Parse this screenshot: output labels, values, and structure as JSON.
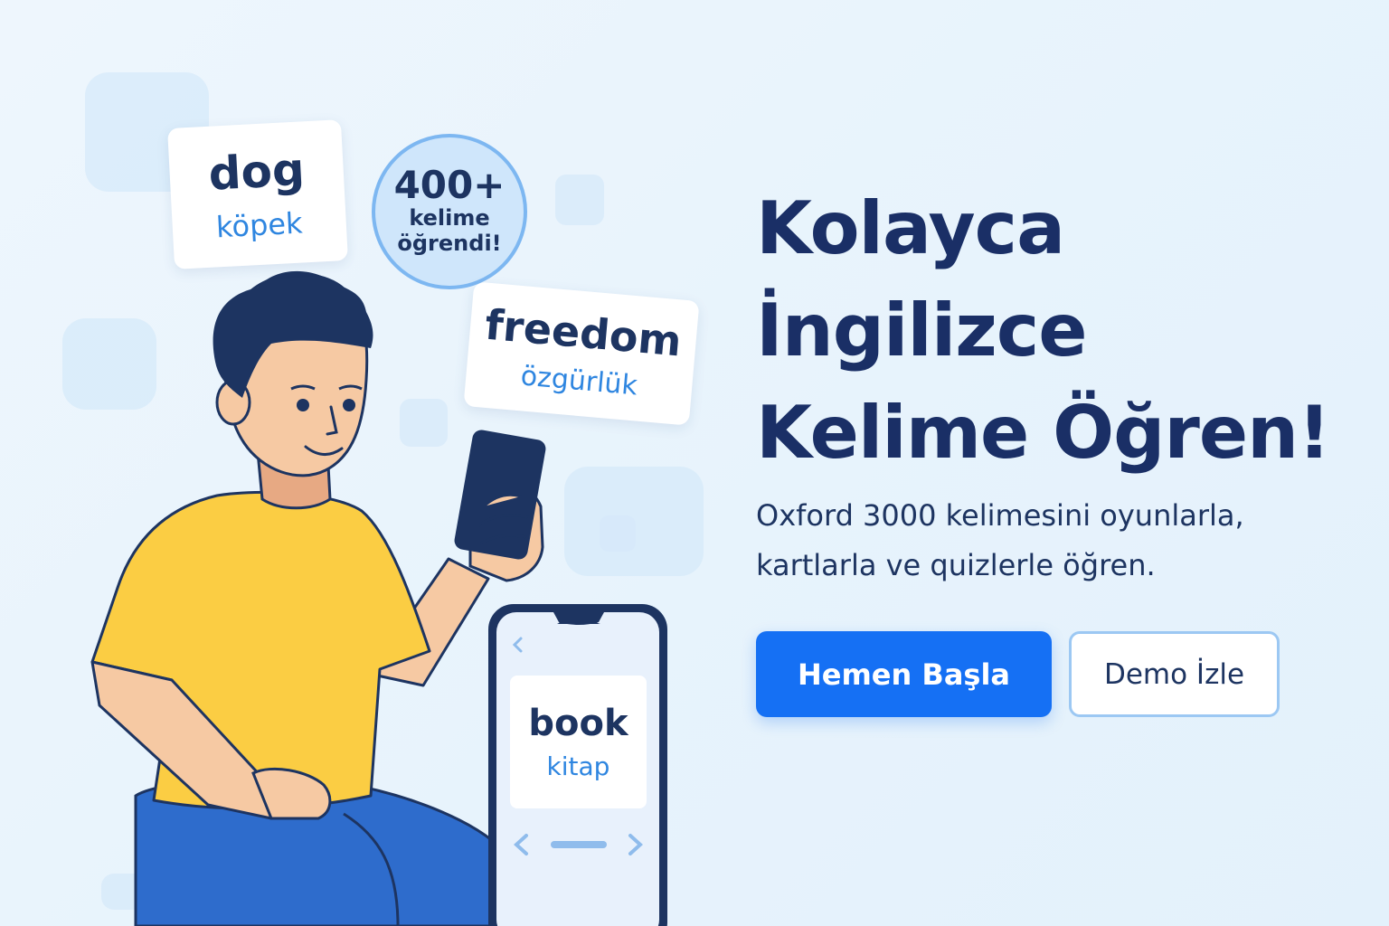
{
  "illustration": {
    "flashcards": [
      {
        "word": "dog",
        "translation": "köpek"
      },
      {
        "word": "freedom",
        "translation": "özgürlük"
      }
    ],
    "badge": {
      "count": "400+",
      "line1": "kelime",
      "line2": "öğrendi!"
    },
    "phone_card": {
      "word": "book",
      "translation": "kitap"
    },
    "phone_icons": [
      "chevron-left-icon",
      "chevron-right-icon"
    ]
  },
  "hero": {
    "headline": [
      "Kolayca",
      "İngilizce",
      "Kelime Öğren!"
    ],
    "subtitle": [
      "Oxford 3000 kelimesini oyunlarla,",
      "kartlarla ve quizlerle öğren."
    ]
  },
  "actions": {
    "primary_label": "Hemen Başla",
    "secondary_label": "Demo İzle"
  },
  "colors": {
    "background": "#e8f4fd",
    "heading": "#1a2f66",
    "primary": "#1570f4",
    "accent_text": "#2f86e0",
    "shirt": "#fbcd43",
    "pants": "#2e6ccc"
  }
}
